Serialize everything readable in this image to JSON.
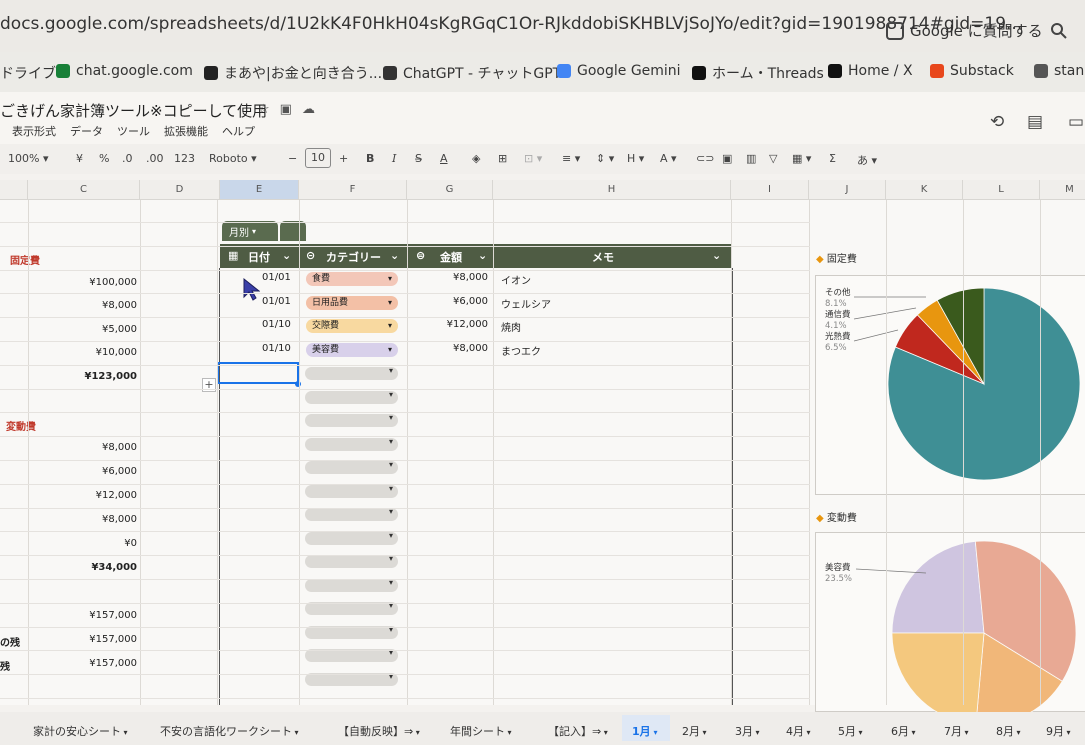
{
  "browser": {
    "url": "docs.google.com/spreadsheets/d/1U2kK4F0HkH04sKgRGqC1Or-RJkddobiSKHBLVjSoJYo/edit?gid=1901988714#gid=19...",
    "ask_google": "Google に質問する"
  },
  "bookmarks": [
    {
      "label": "ドライブ",
      "color": "#f4b400"
    },
    {
      "label": "chat.google.com",
      "color": "#188038"
    },
    {
      "label": "まあや|お金と向き合う...",
      "color": "#222222"
    },
    {
      "label": "ChatGPT - チャットGPT",
      "color": "#333333"
    },
    {
      "label": "Google Gemini",
      "color": "#4285f4"
    },
    {
      "label": "ホーム・Threads",
      "color": "#111111"
    },
    {
      "label": "Home / X",
      "color": "#111111"
    },
    {
      "label": "Substack",
      "color": "#e8471c"
    },
    {
      "label": "stand.",
      "color": "#555555"
    }
  ],
  "doc": {
    "title": "ごきげん家計簿ツール※コピーして使用",
    "menu": [
      "表示形式",
      "データ",
      "ツール",
      "拡張機能",
      "ヘルプ"
    ]
  },
  "toolbar": {
    "zoom": "100%",
    "currency": "¥",
    "percent": "%",
    "dec_decrease": ".0",
    "dec_increase": ".00",
    "number_format": "123",
    "font": "Roboto",
    "minus": "−",
    "font_size": "10",
    "plus": "+",
    "bold": "B",
    "italic": "I",
    "sigma": "Σ",
    "input_tool": "あ"
  },
  "columns": [
    "C",
    "D",
    "E",
    "F",
    "G",
    "H",
    "I",
    "J",
    "K",
    "L",
    "M"
  ],
  "left_summary": {
    "fixed_label": "固定費",
    "fixed_values": [
      "¥100,000",
      "¥8,000",
      "¥5,000",
      "¥10,000"
    ],
    "fixed_total": "¥123,000",
    "variable_label": "変動費",
    "variable_values": [
      "¥8,000",
      "¥6,000",
      "¥12,000",
      "¥8,000",
      "¥0"
    ],
    "variable_total": "¥34,000",
    "totals": [
      "¥157,000",
      "¥157,000",
      "¥157,000"
    ],
    "total_row_labels": [
      "の残",
      "残"
    ]
  },
  "table": {
    "tab_label": "月別",
    "headers": {
      "date": "日付",
      "category": "カテゴリー",
      "amount": "金額",
      "memo": "メモ"
    },
    "rows": [
      {
        "date": "01/01",
        "category": "食費",
        "chip_color": "#f3c7b8",
        "amount": "¥8,000",
        "memo": "イオン"
      },
      {
        "date": "01/01",
        "category": "日用品費",
        "chip_color": "#f3c0a6",
        "amount": "¥6,000",
        "memo": "ウェルシア"
      },
      {
        "date": "01/10",
        "category": "交際費",
        "chip_color": "#f8d9a0",
        "amount": "¥12,000",
        "memo": "焼肉"
      },
      {
        "date": "01/10",
        "category": "美容費",
        "chip_color": "#d8d0ea",
        "amount": "¥8,000",
        "memo": "まつエク"
      }
    ],
    "empty_rows": 14
  },
  "charts": [
    {
      "title": "固定費",
      "legend": [
        {
          "label": "その他",
          "pct": "8.1%"
        },
        {
          "label": "通信費",
          "pct": "4.1%"
        },
        {
          "label": "光熱費",
          "pct": "6.5%"
        }
      ]
    },
    {
      "title": "変動費",
      "legend": [
        {
          "label": "美容費",
          "pct": "23.5%"
        }
      ]
    }
  ],
  "chart_data": [
    {
      "type": "pie",
      "title": "固定費",
      "categories": [
        "",
        "光熱費",
        "通信費",
        "その他"
      ],
      "values": [
        81.3,
        6.5,
        4.1,
        8.1
      ],
      "colors": [
        "#3f8f95",
        "#c0281e",
        "#e8960f",
        "#3a5a1d"
      ]
    },
    {
      "type": "pie",
      "title": "変動費",
      "categories": [
        "美容費",
        "",
        "",
        ""
      ],
      "values": [
        23.5,
        35.3,
        17.6,
        23.6
      ],
      "colors": [
        "#cfc5e0",
        "#e8a994",
        "#f1b779",
        "#f4c87e"
      ]
    }
  ],
  "sheet_tabs": [
    "家計の安心シート",
    "不安の言語化ワークシート",
    "【自動反映】⇒",
    "年間シート",
    "【記入】⇒",
    "1月",
    "2月",
    "3月",
    "4月",
    "5月",
    "6月",
    "7月",
    "8月",
    "9月"
  ],
  "active_tab": "1月"
}
